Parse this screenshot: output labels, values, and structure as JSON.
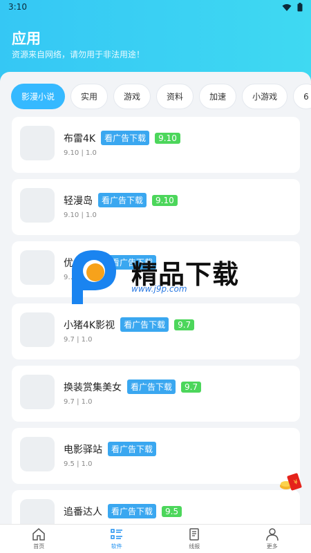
{
  "status_bar": {
    "time": "3:10"
  },
  "header": {
    "title": "应用",
    "subtitle": "资源来自网络，请勿用于非法用途！"
  },
  "tabs": [
    {
      "label": "影漫小说",
      "active": true
    },
    {
      "label": "实用"
    },
    {
      "label": "游戏"
    },
    {
      "label": "资料"
    },
    {
      "label": "加速"
    },
    {
      "label": "小游戏"
    },
    {
      "label": "6"
    }
  ],
  "apps": [
    {
      "name": "布雷4K",
      "ad_label": "看广告下载",
      "score": "9.10",
      "meta": "9.10 | 1.0"
    },
    {
      "name": "轻漫岛",
      "ad_label": "看广告下载",
      "score": "9.10",
      "meta": "9.10 | 1.0"
    },
    {
      "name": "优…动漫",
      "ad_label": "看广告下载",
      "score": "",
      "meta": "9…"
    },
    {
      "name": "小猪4K影视",
      "ad_label": "看广告下载",
      "score": "9.7",
      "meta": "9.7 | 1.0"
    },
    {
      "name": "换装赏集美女",
      "ad_label": "看广告下载",
      "score": "9.7",
      "meta": "9.7 | 1.0"
    },
    {
      "name": "电影驿站",
      "ad_label": "看广告下载",
      "score": "",
      "meta": "9.5 | 1.0"
    },
    {
      "name": "追番达人",
      "ad_label": "看广告下载",
      "score": "9.5",
      "meta": ""
    }
  ],
  "watermark": {
    "text": "精品下载",
    "url": "www.j9p.com"
  },
  "bottom_nav": [
    {
      "label": "首页",
      "icon": "home-icon"
    },
    {
      "label": "软件",
      "icon": "list-icon",
      "active": true
    },
    {
      "label": "线报",
      "icon": "document-icon"
    },
    {
      "label": "更多",
      "icon": "person-icon"
    }
  ],
  "colors": {
    "accent": "#35b9ff",
    "header": "#35c7f4",
    "score": "#4cd65b",
    "ad": "#3aa7f0"
  }
}
